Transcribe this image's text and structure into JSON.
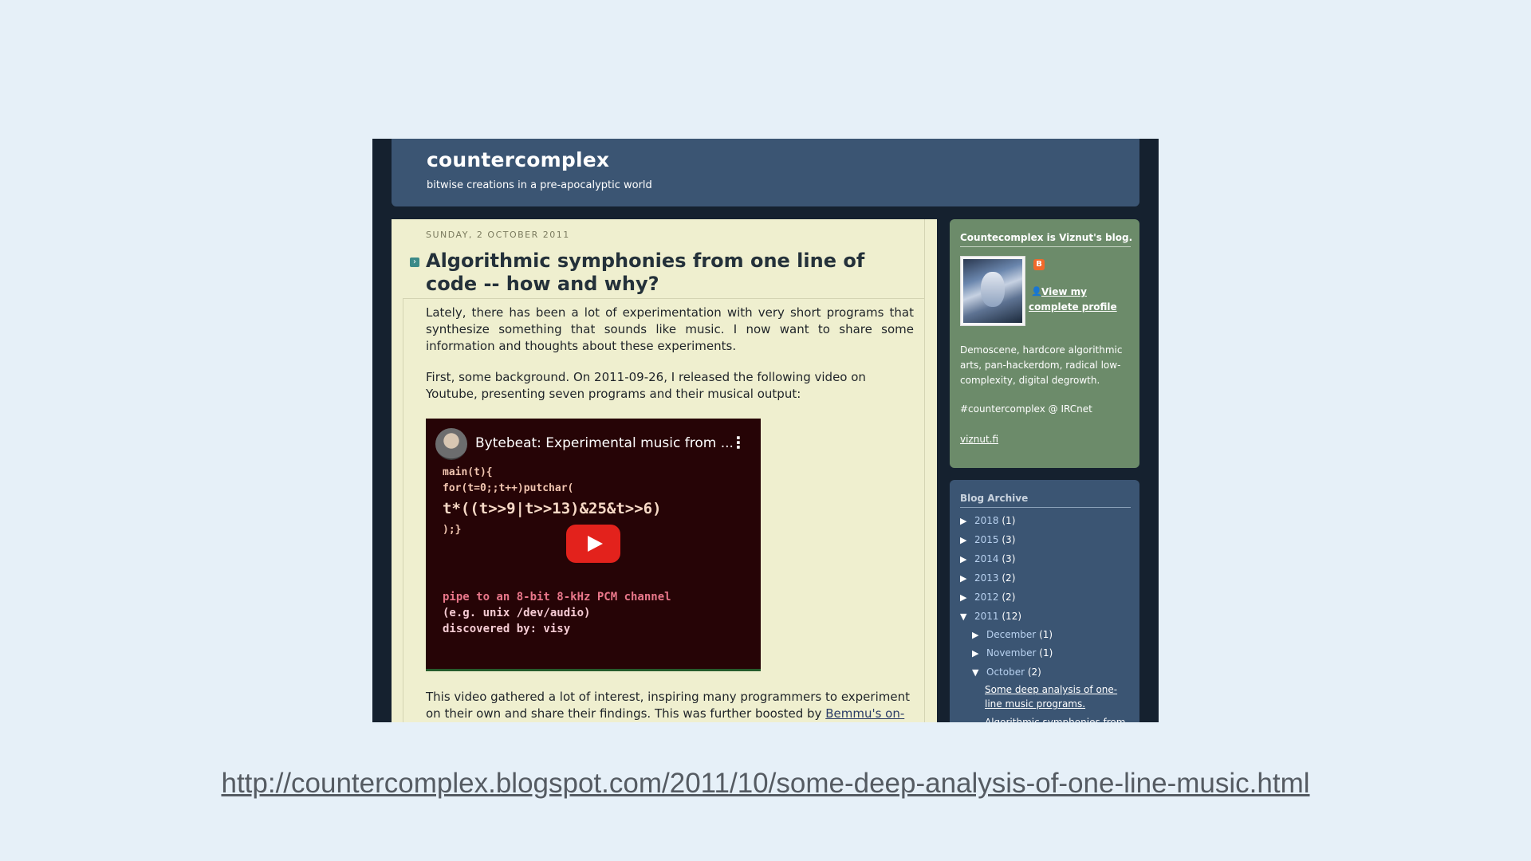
{
  "blog": {
    "title": "countercomplex",
    "description": "bitwise creations in a pre-apocalyptic world"
  },
  "post": {
    "date": "SUNDAY, 2 OCTOBER 2011",
    "title": "Algorithmic symphonies from one line of code -- how and why?",
    "para1": "Lately, there has been a lot of experimentation with very short programs that synthesize something that sounds like music. I now want to share some information and thoughts about these experiments.",
    "para2": "First, some background. On 2011-09-26, I released the following video on Youtube, presenting seven programs and their musical output:",
    "para3_text": "This video gathered a lot of interest, inspiring many programmers to experiment on their own and share their findings. This was further boosted by ",
    "para3_link": "Bemmu's on-line"
  },
  "video": {
    "title": "Bytebeat: Experimental music from ...",
    "menu_icon": "more-vert-icon",
    "code_line1": "main(t){",
    "code_line2": "for(t=0;;t++)putchar(",
    "code_line3": "t*((t>>9|t>>13)&25&t>>6)",
    "code_line4": ");}",
    "pipe_line1": "pipe to an 8-bit 8-kHz PCM channel",
    "pipe_line2": "(e.g. unix /dev/audio)",
    "pipe_line3": "discovered by: visy",
    "play_icon": "youtube-play-icon"
  },
  "sidebar": {
    "profile_title": "Countecomplex is Viznut's blog.",
    "view_profile": "View my complete profile",
    "about": "Demoscene, hardcore algorithmic arts, pan-hackerdom, radical low-complexity, digital degrowth.",
    "irc": "#countercomplex @ IRCnet",
    "site_link": "viznut.fi",
    "archive_title": "Blog Archive",
    "archive": [
      {
        "arrow": "▶",
        "label": "2018",
        "count": "(1)"
      },
      {
        "arrow": "▶",
        "label": "2015",
        "count": "(3)"
      },
      {
        "arrow": "▶",
        "label": "2014",
        "count": "(3)"
      },
      {
        "arrow": "▶",
        "label": "2013",
        "count": "(2)"
      },
      {
        "arrow": "▶",
        "label": "2012",
        "count": "(2)"
      },
      {
        "arrow": "▼",
        "label": "2011",
        "count": "(12)"
      },
      {
        "arrow": "▶",
        "label": "December",
        "count": "(1)"
      },
      {
        "arrow": "▶",
        "label": "November",
        "count": "(1)"
      },
      {
        "arrow": "▼",
        "label": "October",
        "count": "(2)"
      }
    ],
    "archive_posts": [
      "Some deep analysis of one-line music programs.",
      "Algorithmic symphonies from"
    ]
  },
  "caption": {
    "url": "http://countercomplex.blogspot.com/2011/10/some-deep-analysis-of-one-line-music.html"
  }
}
